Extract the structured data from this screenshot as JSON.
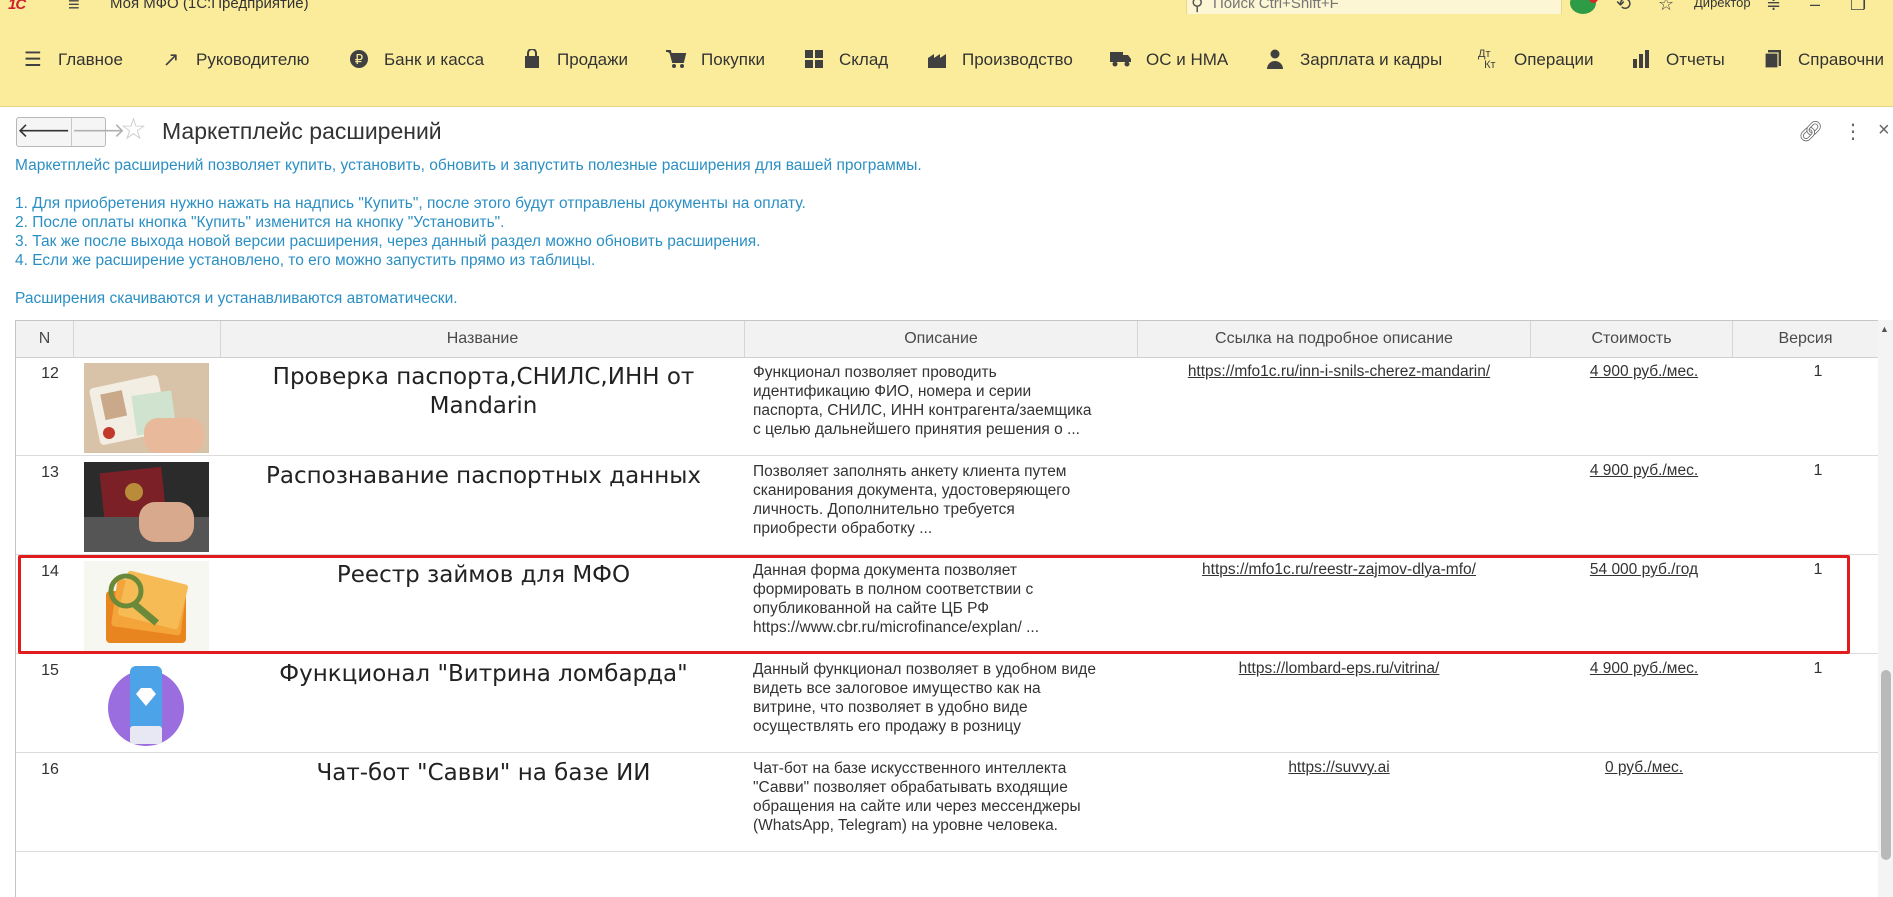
{
  "titlebar": {
    "app_logo": "1С",
    "app_title": "Моя МФО  (1С:Предприятие)",
    "search_placeholder": "Поиск Ctrl+Shift+F",
    "user": "Директор"
  },
  "sections": [
    {
      "label": "Главное",
      "icon": "menu-lines-icon"
    },
    {
      "label": "Руководителю",
      "icon": "trend-chart-icon"
    },
    {
      "label": "Банк и касса",
      "icon": "ruble-coin-icon"
    },
    {
      "label": "Продажи",
      "icon": "shopping-bag-icon"
    },
    {
      "label": "Покупки",
      "icon": "shopping-cart-icon"
    },
    {
      "label": "Склад",
      "icon": "warehouse-grid-icon"
    },
    {
      "label": "Производство",
      "icon": "factory-icon"
    },
    {
      "label": "ОС и НМА",
      "icon": "truck-icon"
    },
    {
      "label": "Зарплата и кадры",
      "icon": "person-icon"
    },
    {
      "label": "Операции",
      "icon": "debit-credit-icon"
    },
    {
      "label": "Отчеты",
      "icon": "bar-chart-icon"
    },
    {
      "label": "Справочни",
      "icon": "book-icon"
    }
  ],
  "form": {
    "title": "Маркетплейс расширений"
  },
  "info": {
    "intro": "Маркетплейс расширений позволяет купить, установить, обновить и запустить полезные расширения для вашей программы.",
    "step1": "1. Для приобретения нужно нажать на надпись \"Купить\", после этого будут отправлены документы на оплату.",
    "step2": "2. После оплаты кнопка \"Купить\" изменится на кнопку \"Установить\".",
    "step3": "3. Так же после выхода новой версии расширения, через данный раздел можно обновить расширения.",
    "step4": "4. Если же расширение установлено, то его можно запустить прямо из таблицы.",
    "auto": "Расширения скачиваются и устанавливаются автоматически."
  },
  "table": {
    "headers": {
      "n": "N",
      "name": "Название",
      "desc": "Описание",
      "link": "Ссылка на подробное описание",
      "price": "Стоимость",
      "version": "Версия"
    },
    "rows": [
      {
        "n": "12",
        "name": "Проверка паспорта,СНИЛС,ИНН от Mandarin",
        "desc": "Функционал позволяет проводить\nидентификацию ФИО, номера и серии\nпаспорта, СНИЛС, ИНН контрагента/заемщика\nс целью дальнейшего принятия решения о ...",
        "link": "https://mfo1c.ru/inn-i-snils-cherez-mandarin/",
        "price": "4 900 руб./мес.",
        "version": "1"
      },
      {
        "n": "13",
        "name": "Распознавание паспортных данных",
        "desc": "Позволяет заполнять анкету клиента путем\nсканирования документа, удостоверяющего\nличность. Дополнительно требуется\nприобрести обработку ...",
        "link": "",
        "price": "4 900 руб./мес.",
        "version": "1"
      },
      {
        "n": "14",
        "name": "Реестр займов для МФО",
        "desc": "Данная форма документа позволяет\nформировать в полном соответствии с\nопубликованной на сайте ЦБ РФ\nhttps://www.cbr.ru/microfinance/explan/ ...",
        "link": "https://mfo1c.ru/reestr-zajmov-dlya-mfo/",
        "price": "54 000 руб./год",
        "version": "1"
      },
      {
        "n": "15",
        "name": "Функционал \"Витрина ломбарда\"",
        "desc": "Данный функционал позволяет в удобном виде\nвидеть все залоговое имущество как на\nвитрине, что позволяет в удобно виде\nосуществлять его продажу в розницу",
        "link": "https://lombard-eps.ru/vitrina/",
        "price": "4 900 руб./мес.",
        "version": "1"
      },
      {
        "n": "16",
        "name": "Чат-бот \"Савви\" на базе ИИ",
        "desc": "Чат-бот на базе искусственного интеллекта\n\"Савви\" позволяет обрабатывать входящие\nобращения на сайте или через мессенджеры\n(WhatsApp, Telegram) на уровне человека.",
        "link": "https://suvvy.ai",
        "price": "0 руб./мес.",
        "version": ""
      }
    ]
  },
  "colors": {
    "header_bg": "#fbec9c",
    "info_text": "#2b8fc4",
    "highlight": "#e01c1c"
  }
}
